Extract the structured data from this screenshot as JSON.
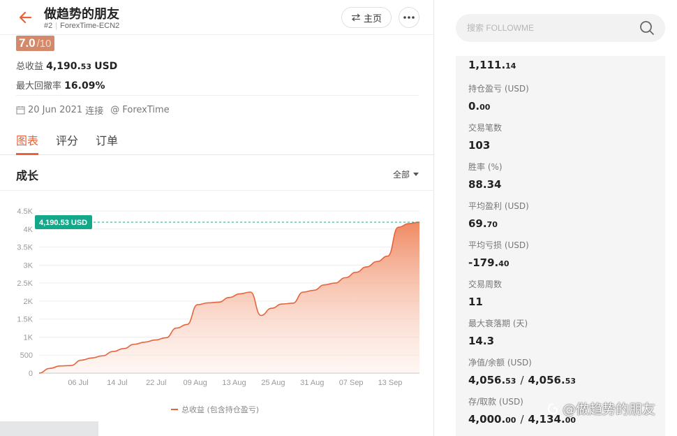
{
  "header": {
    "title": "做趋势的朋友",
    "rank": "#2",
    "account": "ForexTime-ECN2",
    "home_label": "主页"
  },
  "score": {
    "value": "7.0",
    "max": "/10"
  },
  "stats": {
    "total_profit_label": "总收益",
    "total_profit_int": "4,190.",
    "total_profit_dec": "53",
    "total_profit_unit": "USD",
    "max_drawdown_label": "最大回撤率",
    "max_drawdown_value": "16.09%"
  },
  "meta": {
    "date": "20 Jun 2021",
    "connected": "连接",
    "broker": "@ ForexTime"
  },
  "tabs": [
    "图表",
    "评分",
    "订单"
  ],
  "growth": {
    "title": "成长",
    "range": "全部"
  },
  "chart_data": {
    "type": "area",
    "ylabel": "",
    "xlabel": "",
    "y_ticks": [
      "0",
      "500",
      "1K",
      "1.5K",
      "2K",
      "2.5K",
      "3K",
      "3.5K",
      "4K",
      "4.5K"
    ],
    "ylim": [
      0,
      4500
    ],
    "x_ticks": [
      "06 Jul",
      "14 Jul",
      "22 Jul",
      "09 Aug",
      "13 Aug",
      "25 Aug",
      "31 Aug",
      "07 Sep",
      "13 Sep"
    ],
    "current_label": "4,190.53 USD",
    "current_value": 4190.53,
    "legend": "总收益 (包含持仓盈亏)",
    "line_color": "#e8623a",
    "label_color": "#14a88a",
    "series": [
      {
        "values": [
          0,
          130,
          200,
          210,
          360,
          420,
          480,
          600,
          680,
          800,
          860,
          920,
          980,
          1250,
          1350,
          1900,
          1950,
          1970,
          2100,
          2200,
          2250,
          1600,
          1800,
          1920,
          1940,
          2250,
          2300,
          2450,
          2500,
          2650,
          2800,
          2950,
          3100,
          3250,
          4050,
          4150,
          4190.53
        ]
      }
    ]
  },
  "search": {
    "placeholder": "搜索 FOLLOWME"
  },
  "panel": [
    {
      "label": "",
      "int": "1,111.",
      "dec": "14"
    },
    {
      "label": "持仓盈亏 (USD)",
      "int": "0.",
      "dec": "00"
    },
    {
      "label": "交易笔数",
      "int": "103",
      "dec": ""
    },
    {
      "label": "胜率 (%)",
      "int": "88.34",
      "dec": ""
    },
    {
      "label": "平均盈利 (USD)",
      "int": "69.",
      "dec": "70"
    },
    {
      "label": "平均亏损 (USD)",
      "int": "-179.",
      "dec": "40"
    },
    {
      "label": "交易周数",
      "int": "11",
      "dec": ""
    },
    {
      "label": "最大衰落期 (天)",
      "int": "14.3",
      "dec": ""
    }
  ],
  "equity": {
    "label": "净值/余额 (USD)",
    "a_int": "4,056.",
    "a_dec": "53",
    "b_int": "4,056.",
    "b_dec": "53"
  },
  "deposit": {
    "label": "存/取款 (USD)",
    "a_int": "4,000.",
    "a_dec": "00",
    "b_int": "4,134.",
    "b_dec": "00"
  },
  "watermark": "@做趋势的朋友"
}
